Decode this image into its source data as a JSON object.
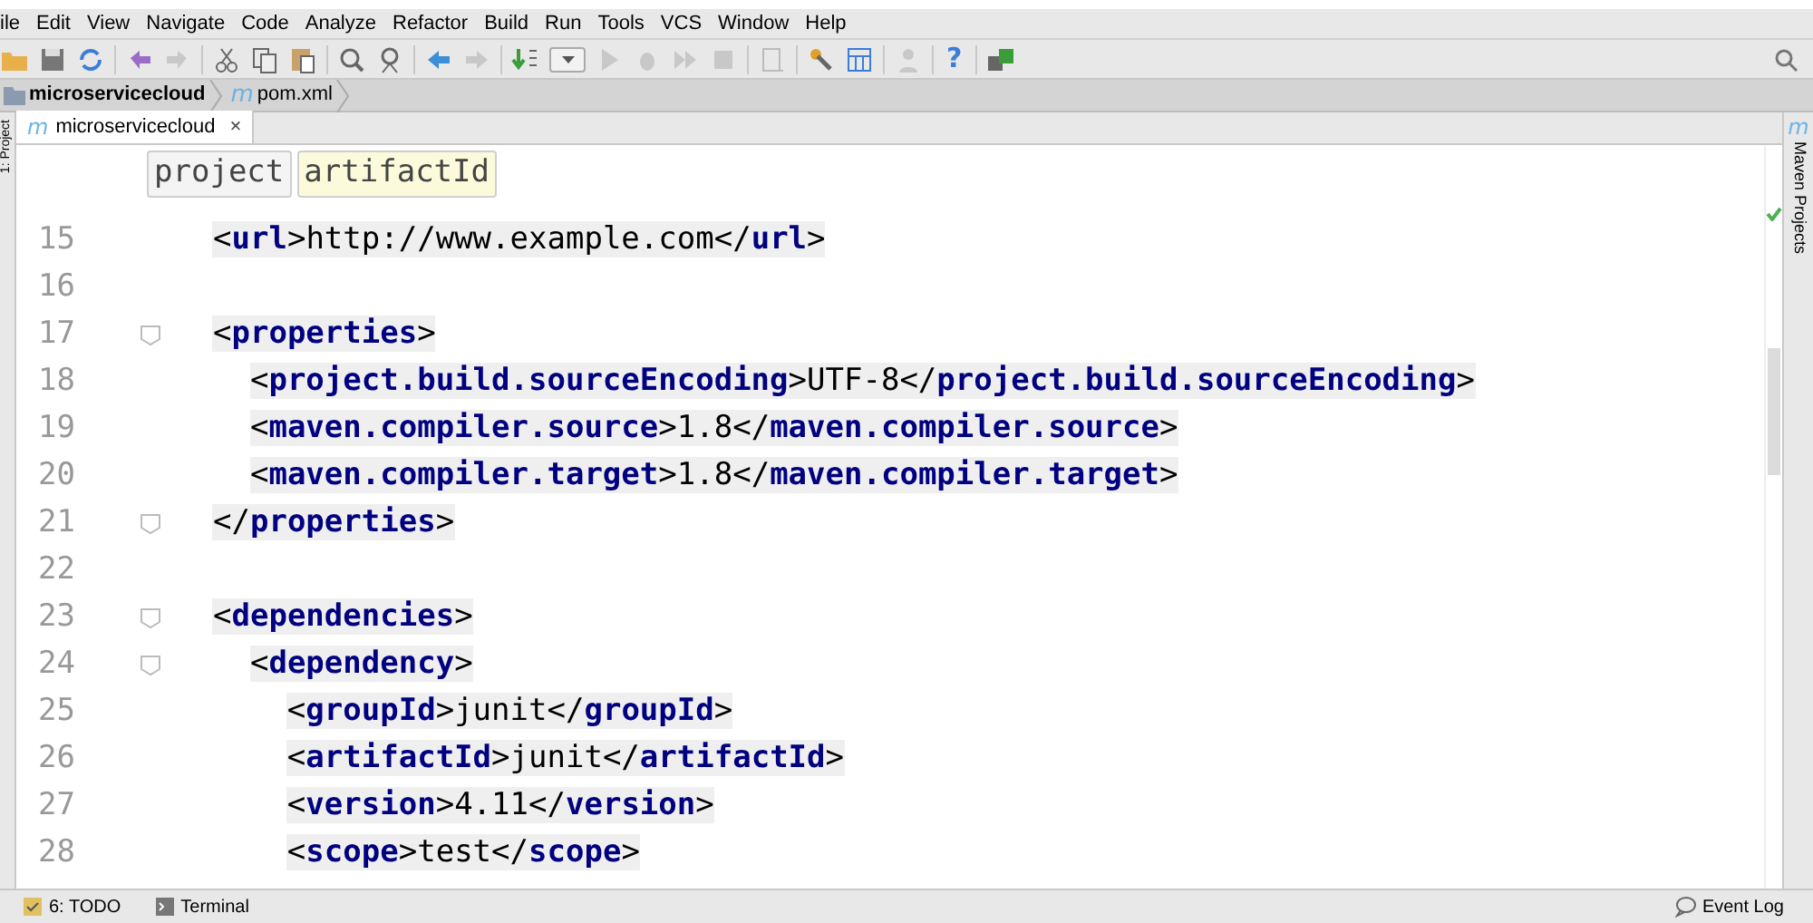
{
  "menu": [
    "ile",
    "Edit",
    "View",
    "Navigate",
    "Code",
    "Analyze",
    "Refactor",
    "Build",
    "Run",
    "Tools",
    "VCS",
    "Window",
    "Help"
  ],
  "toolbar": {
    "help": "?"
  },
  "navigation_bar": [
    {
      "kind": "folder",
      "label": "microservicecloud"
    },
    {
      "kind": "maven",
      "icon": "m",
      "label": "pom.xml"
    }
  ],
  "tabs": [
    {
      "icon": "m",
      "label": "microservicecloud",
      "selected": true,
      "close": "×"
    }
  ],
  "left_stripe": {
    "label": "1: Project"
  },
  "right_stripe": {
    "icon": "m",
    "label": "Maven Projects"
  },
  "breadcrumbs": [
    {
      "label": "project",
      "selected": false
    },
    {
      "label": "artifactId",
      "selected": true
    }
  ],
  "editor_lines": [
    {
      "number": "15",
      "text": "  <url>http://www.example.com</url>",
      "fold": false
    },
    {
      "number": "16",
      "fold": false
    },
    {
      "number": "17",
      "text": "  <properties>",
      "fold": true
    },
    {
      "number": "18",
      "text": "    <project.build.sourceEncoding>UTF-8</project.build.sourceEncoding>",
      "fold": false
    },
    {
      "number": "19",
      "text": "    <maven.compiler.source>1.8</maven.compiler.source>",
      "fold": false
    },
    {
      "number": "20",
      "text": "    <maven.compiler.target>1.8</maven.compiler.target>",
      "fold": false
    },
    {
      "number": "21",
      "text": "  </properties>",
      "fold": true
    },
    {
      "number": "22",
      "fold": false
    },
    {
      "number": "23",
      "text": "  <dependencies>",
      "fold": true
    },
    {
      "number": "24",
      "text": "    <dependency>",
      "fold": true
    },
    {
      "number": "25",
      "text": "      <groupId>junit</groupId>",
      "fold": false
    },
    {
      "number": "26",
      "text": "      <artifactId>junit</artifactId>",
      "fold": false
    },
    {
      "number": "27",
      "text": "      <version>4.11</version>",
      "fold": false
    },
    {
      "number": "28",
      "text": "      <scope>test</scope>",
      "fold": false
    }
  ],
  "status_bar": {
    "left": [
      {
        "kind": "todo",
        "label": "6: TODO"
      },
      {
        "kind": "terminal",
        "label": "Terminal"
      }
    ],
    "right": {
      "label": "Event Log"
    }
  }
}
